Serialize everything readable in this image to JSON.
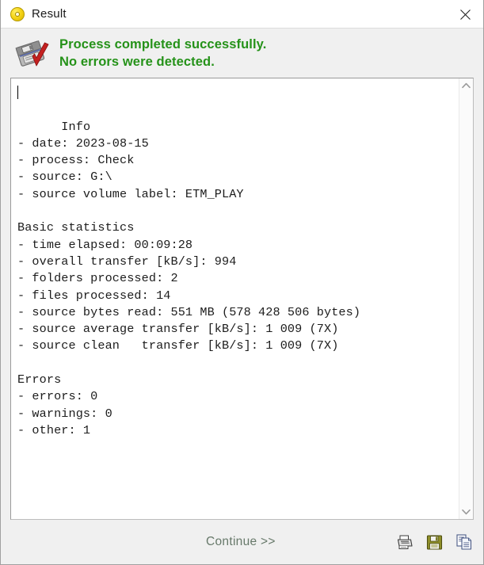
{
  "window": {
    "title": "Result",
    "title_icon": "disc-icon",
    "close_icon": "close-icon"
  },
  "banner": {
    "icon": "disk-check-icon",
    "line1": "Process completed successfully.",
    "line2": "No errors were detected.",
    "color": "#259219"
  },
  "log": {
    "sections": {
      "info_heading": "Info",
      "stats_heading": "Basic statistics",
      "errors_heading": "Errors"
    },
    "lines": [
      "Info",
      "- date: 2023-08-15",
      "- process: Check",
      "- source: G:\\",
      "- source volume label: ETM_PLAY",
      "",
      "Basic statistics",
      "- time elapsed: 00:09:28",
      "- overall transfer [kB/s]: 994",
      "- folders processed: 2",
      "- files processed: 14",
      "- source bytes read: 551 MB (578 428 506 bytes)",
      "- source average transfer [kB/s]: 1 009 (7X)",
      "- source clean   transfer [kB/s]: 1 009 (7X)",
      "",
      "Errors",
      "- errors: 0",
      "- warnings: 0",
      "- other: 1"
    ],
    "values": {
      "date": "2023-08-15",
      "process": "Check",
      "source": "G:\\",
      "source_volume_label": "ETM_PLAY",
      "time_elapsed": "00:09:28",
      "overall_transfer_kbs": "994",
      "folders_processed": "2",
      "files_processed": "14",
      "source_bytes_read": "551 MB (578 428 506 bytes)",
      "source_average_transfer": "1 009 (7X)",
      "source_clean_transfer": "1 009 (7X)",
      "errors": "0",
      "warnings": "0",
      "other": "1"
    }
  },
  "scrollbar": {
    "up_icon": "chevron-up-icon",
    "down_icon": "chevron-down-icon"
  },
  "footer": {
    "continue_label": "Continue >>",
    "icons": [
      {
        "name": "print-icon",
        "label": "Print"
      },
      {
        "name": "save-icon",
        "label": "Save"
      },
      {
        "name": "copy-icon",
        "label": "Copy"
      }
    ]
  }
}
